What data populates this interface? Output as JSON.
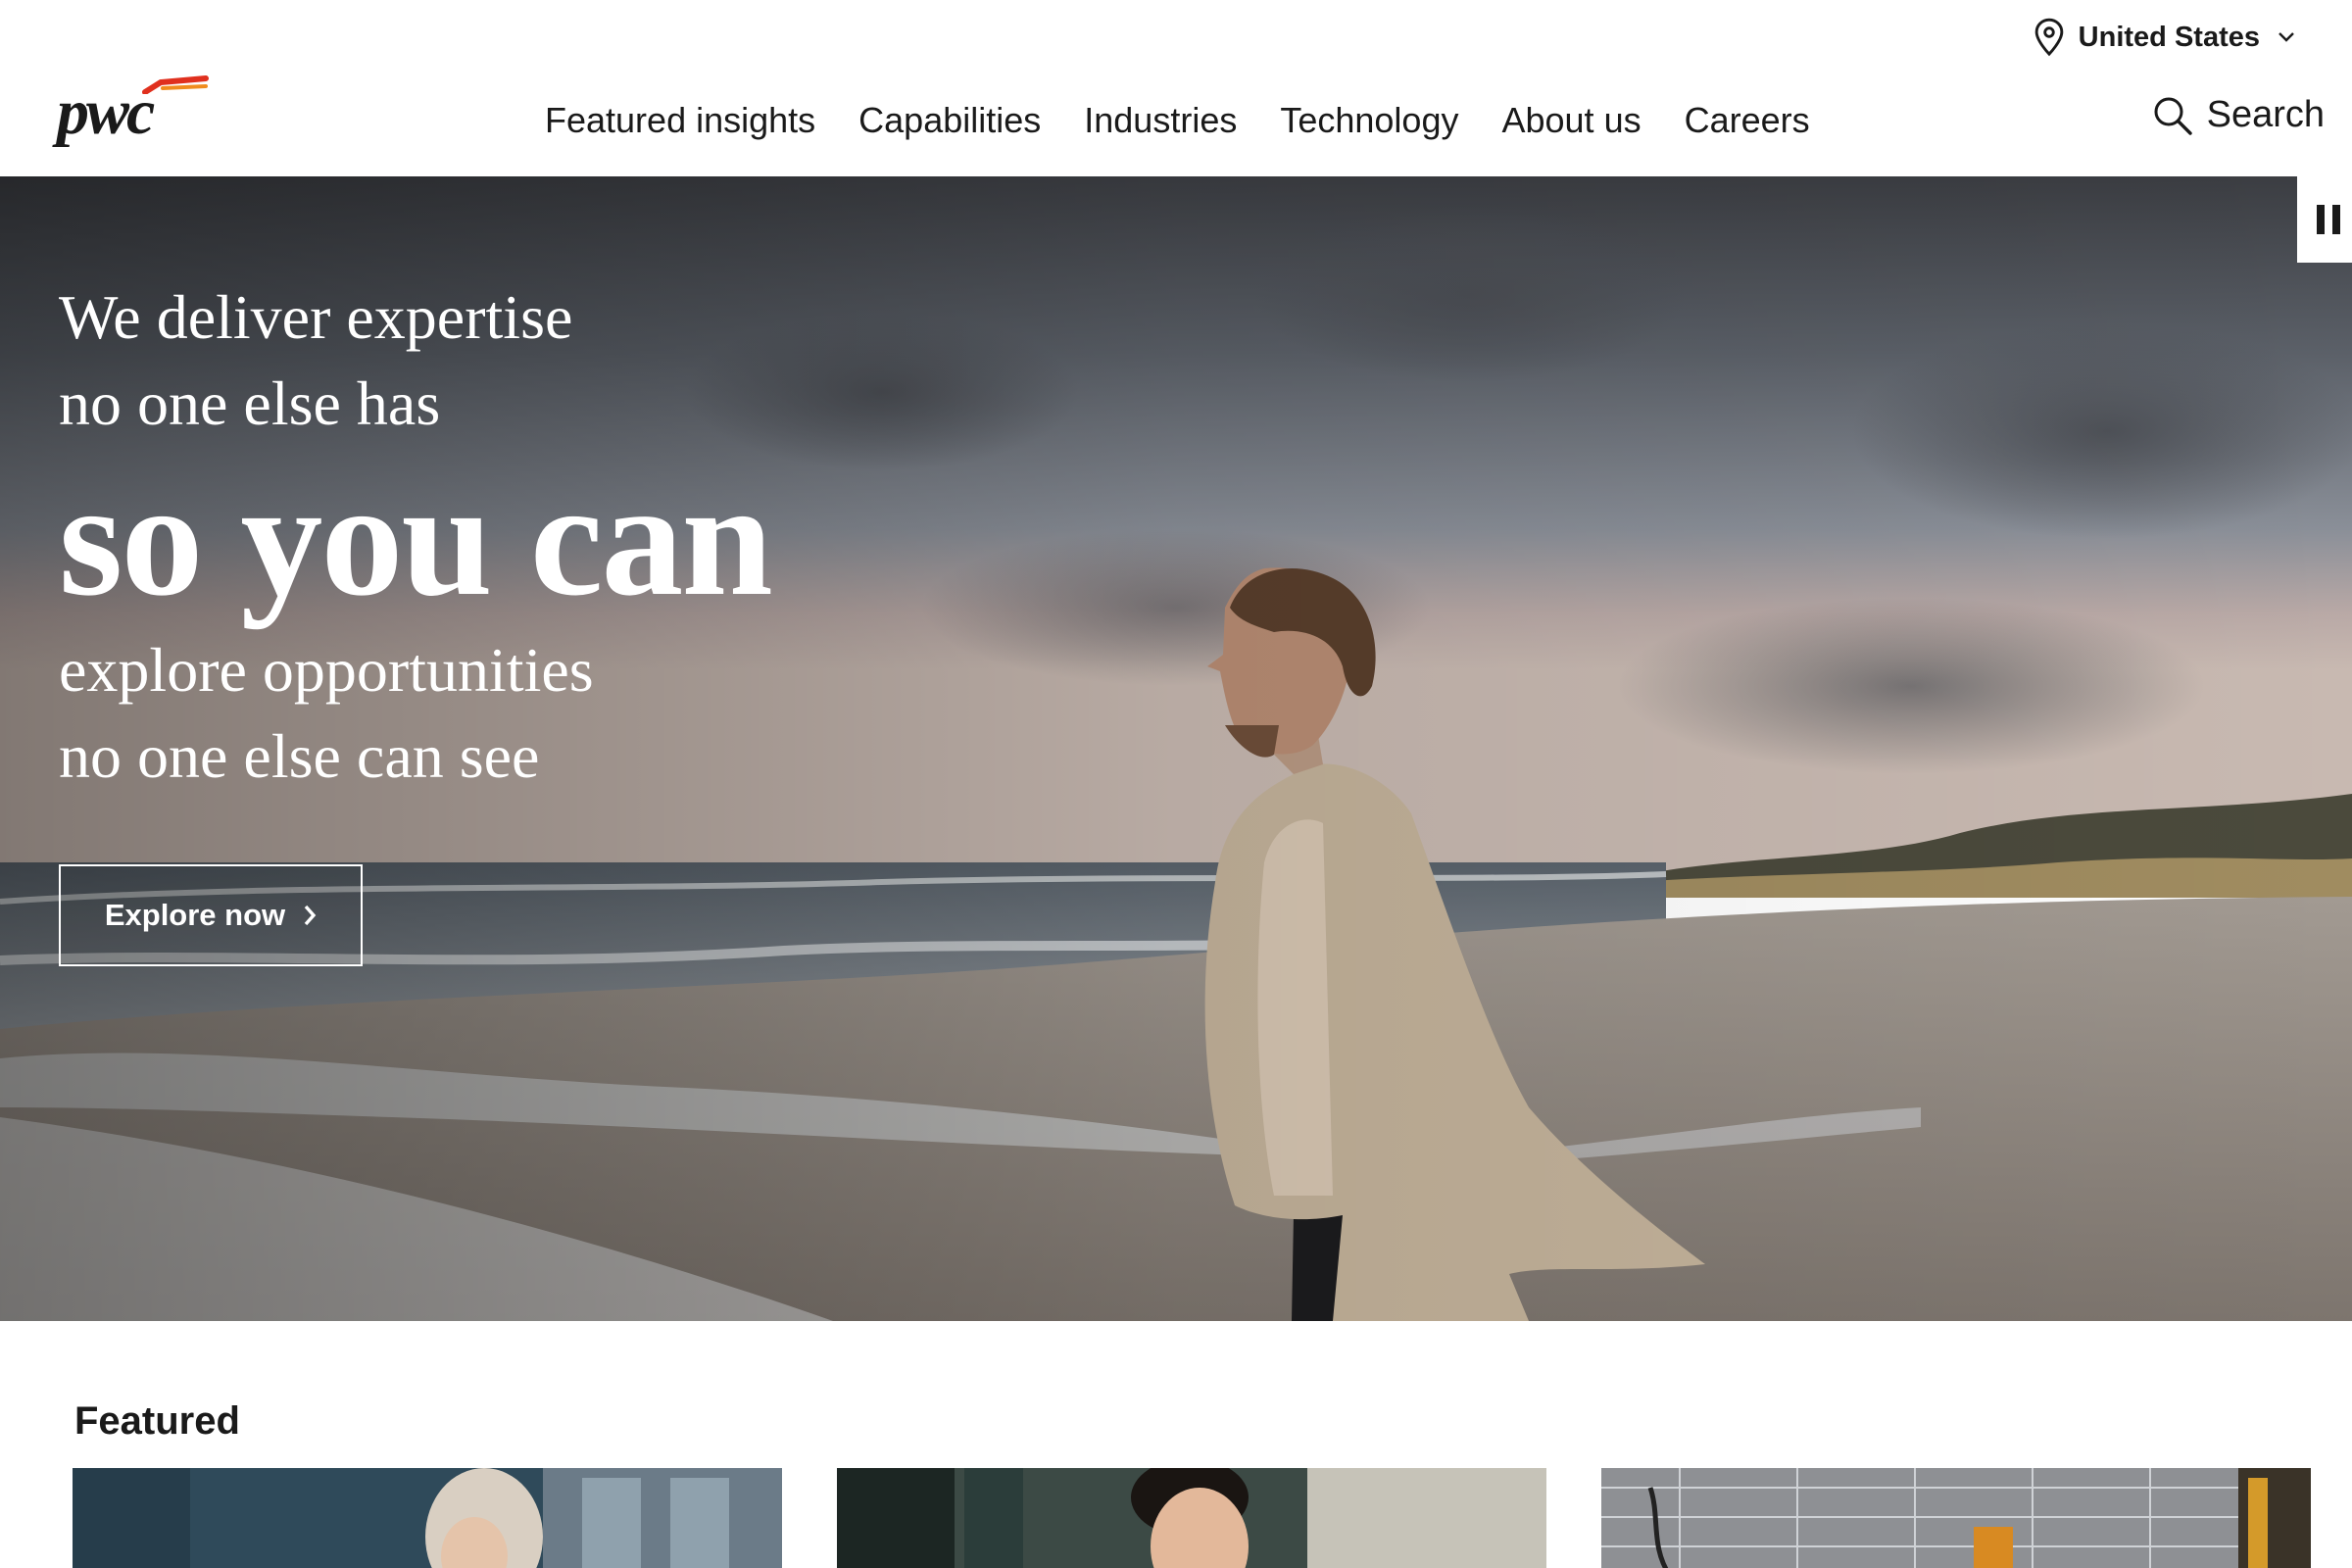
{
  "header": {
    "location": "United States",
    "nav": [
      {
        "label": "Featured insights"
      },
      {
        "label": "Capabilities"
      },
      {
        "label": "Industries"
      },
      {
        "label": "Technology"
      },
      {
        "label": "About us"
      },
      {
        "label": "Careers"
      }
    ],
    "search_label": "Search"
  },
  "logo": {
    "text": "pwc",
    "accent_color": "#e0301e"
  },
  "hero": {
    "line1": "We deliver expertise",
    "line2": "no one else has",
    "big": "so you can",
    "line3": "explore opportunities",
    "line4": "no one else can see",
    "cta": "Explore now"
  },
  "featured": {
    "title": "Featured",
    "cards": [
      {
        "image": "woman-office-photo"
      },
      {
        "image": "smiling-woman-photo"
      },
      {
        "image": "factory-robotics-photo"
      }
    ]
  },
  "colors": {
    "text": "#1a1a1a",
    "background": "#ffffff",
    "brand_orange": "#e0301e"
  }
}
